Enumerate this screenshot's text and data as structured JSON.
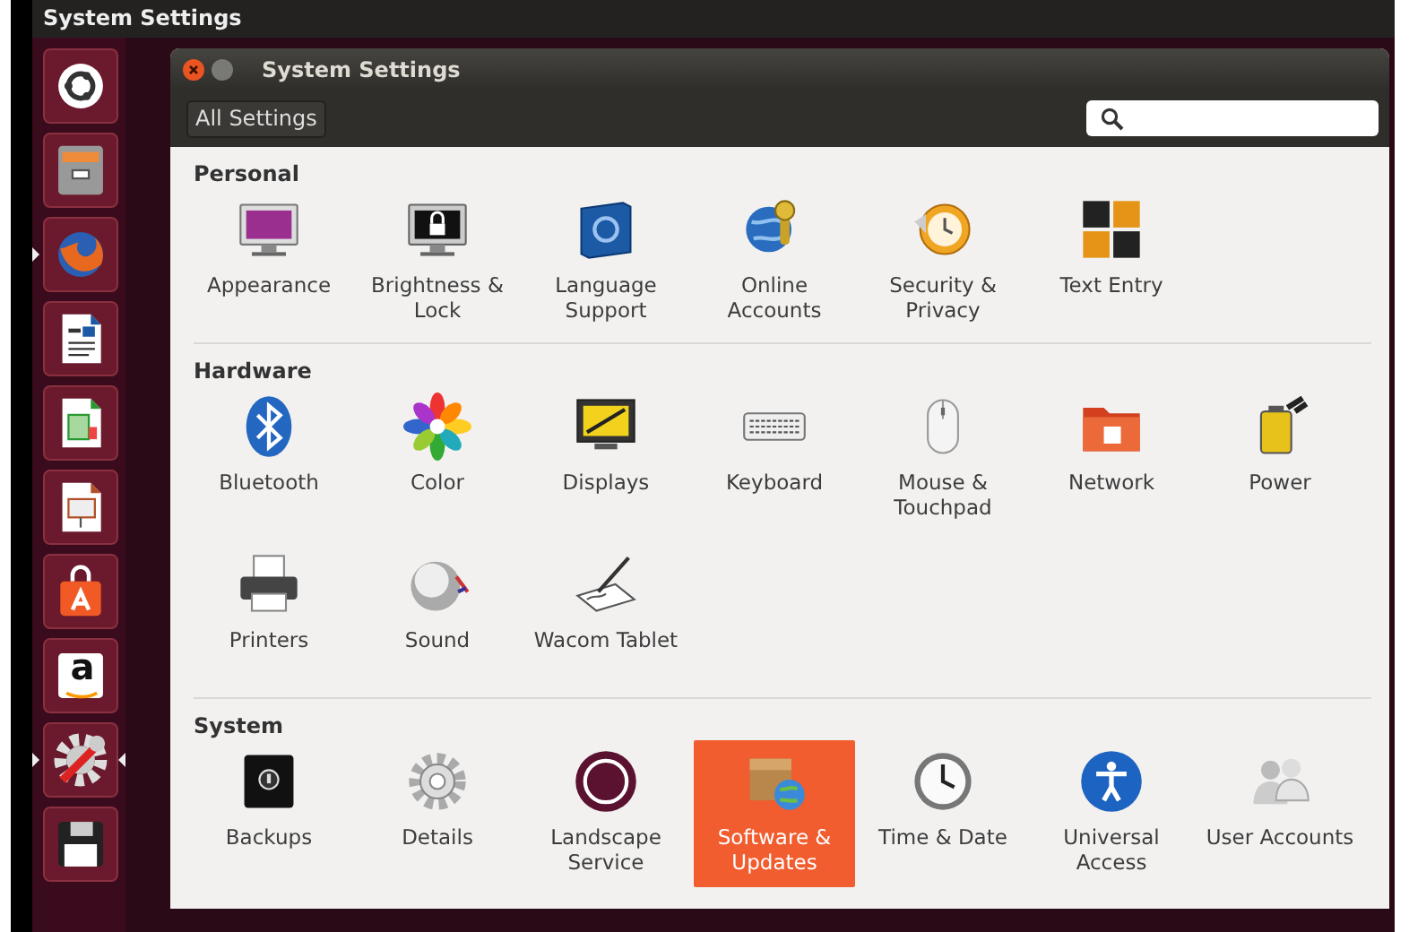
{
  "panel": {
    "title": "System Settings"
  },
  "launcher": [
    {
      "kind": "circle-logo",
      "running": false,
      "focused": false
    },
    {
      "kind": "file-cabinet",
      "running": false,
      "focused": false
    },
    {
      "kind": "fox-globe",
      "running": true,
      "focused": false
    },
    {
      "kind": "document",
      "running": false,
      "focused": false
    },
    {
      "kind": "spreadsheet",
      "running": false,
      "focused": false
    },
    {
      "kind": "presentation",
      "running": false,
      "focused": false
    },
    {
      "kind": "shopping-bag",
      "running": false,
      "focused": false
    },
    {
      "kind": "letter-tile",
      "glyph": "a",
      "running": false,
      "focused": false
    },
    {
      "kind": "gear-wrench",
      "running": true,
      "focused": true
    },
    {
      "kind": "floppy-disk",
      "running": false,
      "focused": false
    }
  ],
  "window": {
    "title": "System Settings",
    "all_settings_button": "All Settings"
  },
  "sections": [
    {
      "title": "Personal",
      "items": [
        {
          "label": "Appearance",
          "kind": "monitor",
          "selected": false
        },
        {
          "label": "Brightness & Lock",
          "kind": "padlock-monitor",
          "selected": false
        },
        {
          "label": "Language Support",
          "kind": "flag",
          "selected": false
        },
        {
          "label": "Online Accounts",
          "kind": "globe-key",
          "selected": false
        },
        {
          "label": "Security & Privacy",
          "kind": "clock-shield",
          "selected": false
        },
        {
          "label": "Text Entry",
          "kind": "key-tiles",
          "selected": false
        }
      ]
    },
    {
      "title": "Hardware",
      "items": [
        {
          "label": "Bluetooth",
          "kind": "bluetooth",
          "selected": false
        },
        {
          "label": "Color",
          "kind": "petal-flower",
          "selected": false
        },
        {
          "label": "Displays",
          "kind": "display",
          "selected": false
        },
        {
          "label": "Keyboard",
          "kind": "keyboard",
          "selected": false
        },
        {
          "label": "Mouse & Touchpad",
          "kind": "mouse",
          "selected": false
        },
        {
          "label": "Network",
          "kind": "folder",
          "selected": false
        },
        {
          "label": "Power",
          "kind": "battery-plug",
          "selected": false
        },
        {
          "label": "Printers",
          "kind": "printer",
          "selected": false
        },
        {
          "label": "Sound",
          "kind": "speaker-ball",
          "selected": false
        },
        {
          "label": "Wacom Tablet",
          "kind": "tablet-pen",
          "selected": false
        }
      ]
    },
    {
      "title": "System",
      "items": [
        {
          "label": "Backups",
          "kind": "safe",
          "selected": false
        },
        {
          "label": "Details",
          "kind": "gear",
          "selected": false
        },
        {
          "label": "Landscape Service",
          "kind": "ring",
          "selected": false
        },
        {
          "label": "Software & Updates",
          "kind": "package-globe",
          "selected": true
        },
        {
          "label": "Time & Date",
          "kind": "clock",
          "selected": false
        },
        {
          "label": "Universal Access",
          "kind": "accessibility",
          "selected": false
        },
        {
          "label": "User Accounts",
          "kind": "users",
          "selected": false
        }
      ]
    }
  ]
}
